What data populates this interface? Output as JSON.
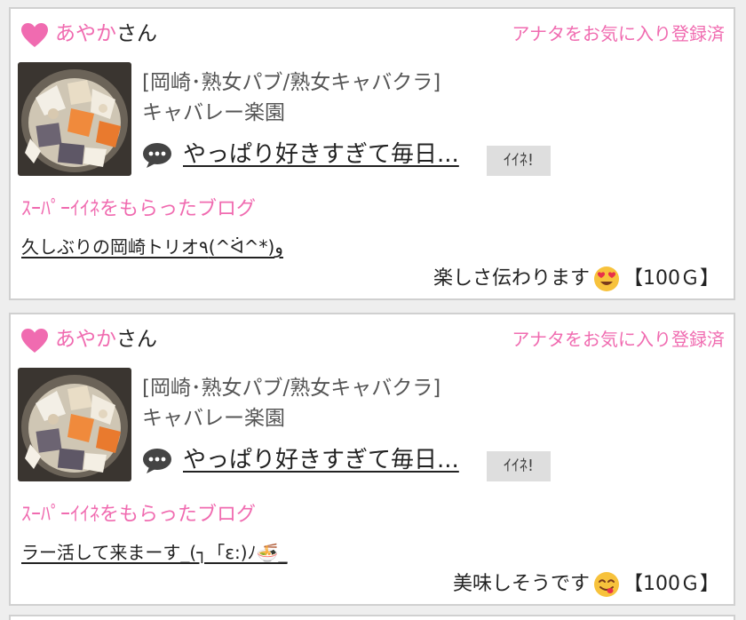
{
  "feed": {
    "items": [
      {
        "user_name": "あやか",
        "honorific": "さん",
        "favorite_status": "アナタをお気に入り登録済",
        "shop_category": "[岡崎･熟女パブ/熟女キャバクラ]",
        "shop_name": "キャバレー楽園",
        "post_title": "やっぱり好きすぎて毎日...",
        "iine_label": "ｲｲﾈ!",
        "super_label": "ｽｰﾊﾟｰｲｲﾈをもらったブログ",
        "blog_title": "久しぶりの岡崎トリオ٩(^ᐛ^*)و",
        "comment": "楽しさ伝わります",
        "comment_emoji": "heart-eyes-emoji",
        "points": "【100Ｇ】"
      },
      {
        "user_name": "あやか",
        "honorific": "さん",
        "favorite_status": "アナタをお気に入り登録済",
        "shop_category": "[岡崎･熟女パブ/熟女キャバクラ]",
        "shop_name": "キャバレー楽園",
        "post_title": "やっぱり好きすぎて毎日...",
        "iine_label": "ｲｲﾈ!",
        "super_label": "ｽｰﾊﾟｰｲｲﾈをもらったブログ",
        "blog_title": "ラー活して来まーす_(┐「ε:)ﾉ🍜_",
        "comment": "美味しそうです",
        "comment_emoji": "yum-emoji",
        "points": "【100Ｇ】"
      }
    ]
  },
  "colors": {
    "accent_pink": "#f06bb0",
    "button_gray": "#dedede",
    "border_gray": "#d0d0d0"
  },
  "icons": {
    "heart": "heart-icon",
    "speech": "speech-bubble-icon"
  }
}
